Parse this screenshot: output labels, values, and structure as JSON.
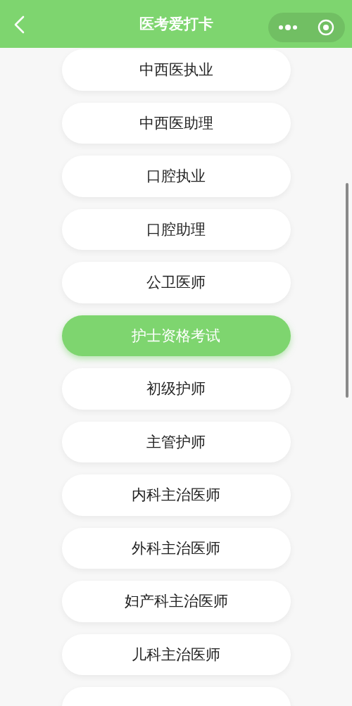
{
  "header": {
    "title": "医考爱打卡"
  },
  "exams": [
    {
      "label": "中西医执业",
      "selected": false
    },
    {
      "label": "中西医助理",
      "selected": false
    },
    {
      "label": "口腔执业",
      "selected": false
    },
    {
      "label": "口腔助理",
      "selected": false
    },
    {
      "label": "公卫医师",
      "selected": false
    },
    {
      "label": "护士资格考试",
      "selected": true
    },
    {
      "label": "初级护师",
      "selected": false
    },
    {
      "label": "主管护师",
      "selected": false
    },
    {
      "label": "内科主治医师",
      "selected": false
    },
    {
      "label": "外科主治医师",
      "selected": false
    },
    {
      "label": "妇产科主治医师",
      "selected": false
    },
    {
      "label": "儿科主治医师",
      "selected": false
    },
    {
      "selected": false
    }
  ]
}
